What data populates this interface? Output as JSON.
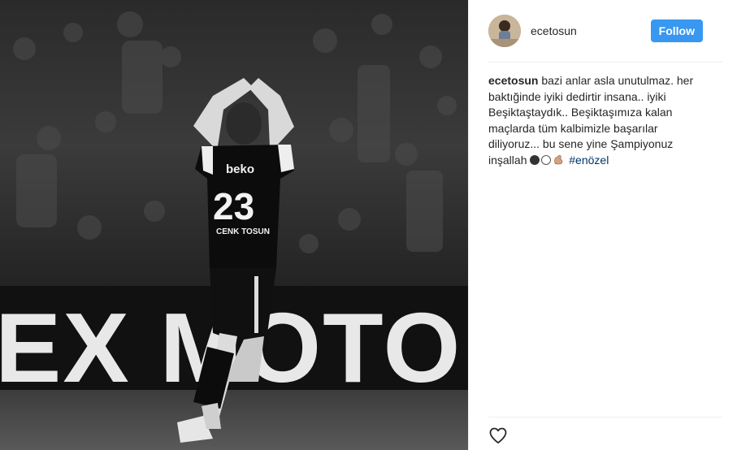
{
  "post": {
    "username": "ecetosun",
    "follow_label": "Follow",
    "caption": {
      "username": "ecetosun",
      "text": "bazi anlar asla unutulmaz. her baktığinde iyiki dedirtir insana.. iyiki Beşiktaştaydık.. Beşiktaşımıza kalan maçlarda tüm kalbimizle başarılar diliyoruz... bu sene yine Şampiyonuz inşallah",
      "emojis": [
        "black-circle",
        "white-circle",
        "flexed-biceps"
      ],
      "hashtag": "#enözel"
    }
  },
  "photo": {
    "jersey_number": "23",
    "jersey_sponsor": "beko",
    "jersey_name": "CENK TOSUN",
    "banner_text": "EX MOTOR OI"
  },
  "icons": {
    "like": "heart-icon"
  },
  "colors": {
    "follow_bg": "#3897f0",
    "hashtag": "#003569",
    "text": "#262626",
    "divider": "#efefef"
  }
}
